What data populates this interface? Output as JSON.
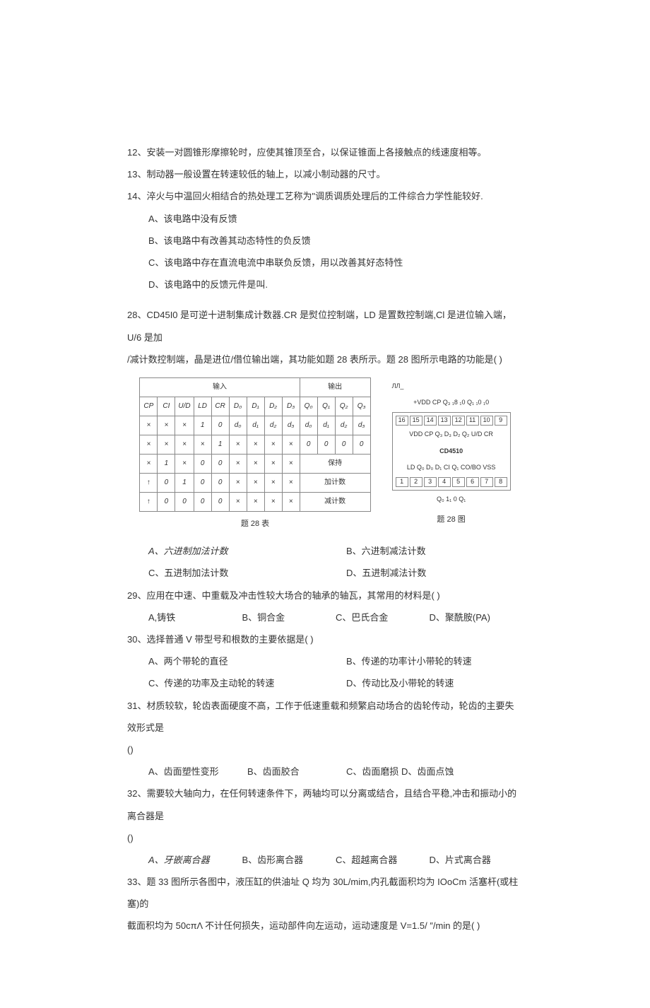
{
  "q12": "12、安装一对圆锥形摩擦轮时，应使其锥顶至合，以保证锥面上各接触点的线速度相等。",
  "q13": "13、制动器一般设置在转速较低的轴上，以减小制动器的尺寸。",
  "q14": "14、淬火与中温回火相结合的热处理工艺称为\"调质调质处理后的工件综合力学性能较好.",
  "q14a": "A、该电路中没有反馈",
  "q14b": "B、该电路中有改善其动态特性的负反馈",
  "q14c": "C、该电路中存在直流电流中串联负反馈，用以改善其好态特性",
  "q14d": "D、该电路中的反馈元件是叫.",
  "q28_1": "28、CD45I0 是可逆十进制集成计数器.CR 是熨位控制端，LD 是置数控制端,Cl 是进位输入端，U/6 是加",
  "q28_2": "/减计数控制端，晶是进位/借位输出端，其功能如题 28 表所示。题 28 图所示电路的功能是(               )",
  "table": {
    "header_in": "输入",
    "header_out": "输出",
    "cols": [
      "CP",
      "CI",
      "U/D",
      "LD",
      "CR",
      "D₀",
      "D₁",
      "D₂",
      "D₃",
      "Q₀",
      "Q₁",
      "Q₂",
      "Q₃"
    ],
    "rows": [
      [
        "×",
        "×",
        "×",
        "1",
        "0",
        "d₀",
        "d₁",
        "d₂",
        "d₃",
        "d₀",
        "d₁",
        "d₂",
        "d₃"
      ],
      [
        "×",
        "×",
        "×",
        "×",
        "1",
        "×",
        "×",
        "×",
        "×",
        "0",
        "0",
        "0",
        "0"
      ],
      [
        "×",
        "1",
        "×",
        "0",
        "0",
        "×",
        "×",
        "×",
        "×",
        "保持",
        "",
        "",
        ""
      ],
      [
        "↑",
        "0",
        "1",
        "0",
        "0",
        "×",
        "×",
        "×",
        "×",
        "加计数",
        "",
        "",
        ""
      ],
      [
        "↑",
        "0",
        "0",
        "0",
        "0",
        "×",
        "×",
        "×",
        "×",
        "减计数",
        "",
        "",
        ""
      ]
    ],
    "caption": "题 28 表"
  },
  "chip": {
    "signal": "ЛЛ_",
    "top_labels": "+VDD   CP  Q₃ ₁8  ₁0    Q₁ ₁0  ₁0",
    "pins_top": [
      "16",
      "15",
      "14",
      "13",
      "12",
      "11",
      "10",
      "9"
    ],
    "row1": "VDD CP   Q₃   D₃   D₂    Q₂  U/D CR",
    "name": "CD4510",
    "row2": "LD  Q₀  D₀  D₁  CI  Q₁ CO/BO VSS",
    "pins_bot": [
      "1",
      "2",
      "3",
      "4",
      "5",
      "6",
      "7",
      "8"
    ],
    "bot_labels": "Q₀        1₁  0   Q₁",
    "caption": "题 28 图"
  },
  "q28a": "A、六进制加法计数",
  "q28b": "B、六进制减法计数",
  "q28c": "C、五进制加法计数",
  "q28d": "D、五进制减法计数",
  "q29": "29、应用在中速、中重载及冲击性较大场合的轴承的轴瓦，其常用的材料是(           )",
  "q29a": "A,铸铁",
  "q29b": "B、铜合金",
  "q29c": "C、巴氏合金",
  "q29d": "D、聚酰胺(PA)",
  "q30": "30、选择普通 V 带型号和根数的主要依据是(         )",
  "q30a": "A、两个带轮的直径",
  "q30b": "B、传递的功率计小带轮的转速",
  "q30c": "C、传递的功率及主动轮的转速",
  "q30d": "D、传动比及小带轮的转速",
  "q31_1": "31、材质较软，轮齿表面硬度不高，工作于低速重载和频繁启动场合的齿轮传动，轮齿的主要失效形式是",
  "q31_2": "()",
  "q31a": "A、齿面塑性变形",
  "q31b": "B、齿面胶合",
  "q31c": "C、齿面磨损 D、齿面点蚀",
  "q32_1": "32、需要较大轴向力，在任何转速条件下，两轴均可以分离或结合，且结合平稳,冲击和振动小的离合器是",
  "q32_2": "()",
  "q32a": "A、牙嵌离合器",
  "q32b": "B、齿形离合器",
  "q32c": "C、超越离合器",
  "q32d": "D、片式离合器",
  "q33_1": "33、题 33 图所示各图中，液压缸的供油址 Q 均为 30L/mim,内孔截面积均为 IOoCm 活塞杆(或柱塞)的",
  "q33_2": "截面积均为 50cπΛ 不计任何损失，运动部件向左运动，运动速度是 V=1.5/ ″/min 的是(                  )"
}
